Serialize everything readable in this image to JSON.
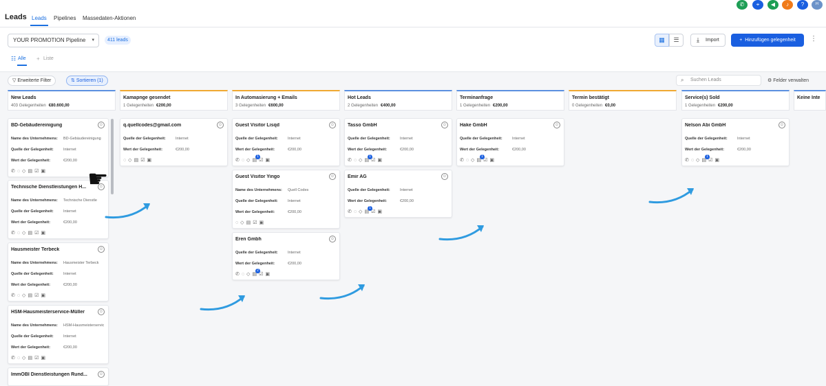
{
  "header": {
    "title": "Leads",
    "tabs": [
      "Leads",
      "Pipelines",
      "Massedaten-Aktionen"
    ],
    "active_tab": "Leads",
    "icons": [
      {
        "name": "phone-icon",
        "color": "#1e9e55",
        "glyph": "✆"
      },
      {
        "name": "dialer-icon",
        "color": "#1a5fe0",
        "glyph": "⌖"
      },
      {
        "name": "megaphone-icon",
        "color": "#1e9e55",
        "glyph": "◀"
      },
      {
        "name": "bell-icon",
        "color": "#f07b1a",
        "glyph": "♪"
      },
      {
        "name": "help-icon",
        "color": "#1a5fe0",
        "glyph": "?"
      },
      {
        "name": "user-avatar-icon",
        "color": "#6c93c9",
        "glyph": "ᴴ"
      }
    ]
  },
  "toolbar": {
    "pipeline": "YOUR PROMOTION Pipeline",
    "lead_count": "411 leads",
    "import_label": "Import",
    "add_label": "Hinzufügen gelegenheit",
    "view_tabs": [
      "Alle",
      "Liste"
    ]
  },
  "filters": {
    "extended": "Erweiterte Filter",
    "sort": "Sortieren (1)",
    "search_placeholder": "Suchen Leads",
    "manage_fields": "Felder verwalten"
  },
  "labels": {
    "company": "Name des Unternehmens:",
    "source": "Quelle der Gelegenheit:",
    "value": "Wert der Gelegenheit:"
  },
  "columns": [
    {
      "title": "New Leads",
      "count": "403 Gelegenheiten",
      "amount": "€80.600,00",
      "color": "#5a8fe0",
      "cards": [
        {
          "name": "BD-Gebäudereinigung",
          "company": "BD-Gebäudereinigung",
          "source": "Internet",
          "value": "€200,00"
        },
        {
          "name": "Technische Dienstleistungen H...",
          "company": "Technische Dienstle",
          "source": "Internet",
          "value": "€200,00"
        },
        {
          "name": "Hausmeister Terbeck",
          "company": "Hausmeister Terbeck",
          "source": "Internet",
          "value": "€200,00"
        },
        {
          "name": "HSM-Hausmeisterservice-Müller",
          "company": "HSM-Hausmeisterservic",
          "source": "Internet",
          "value": "€200,00"
        },
        {
          "name": "ImmOBI Dienstleistungen Rund...",
          "company": "",
          "source": "",
          "value": ""
        }
      ]
    },
    {
      "title": "Kamapnge gesendet",
      "count": "1 Gelegenheiten",
      "amount": "€200,00",
      "color": "#f0a830",
      "cards": [
        {
          "name": "q.quellcodes@gmail.com",
          "company": "",
          "source": "Internet",
          "value": "€200,00"
        }
      ]
    },
    {
      "title": "In Automasierung + Emails",
      "count": "3 Gelegenheiten",
      "amount": "€600,00",
      "color": "#f0a830",
      "cards": [
        {
          "name": "Guest Visitor Lisqd",
          "company": "",
          "source": "Internet",
          "value": "€200,00",
          "badge": "1"
        },
        {
          "name": "Guest Visitor Yingo",
          "company": "Quell Codes",
          "source": "Internet",
          "value": "€200,00"
        },
        {
          "name": "Eren Gmbh",
          "company": "",
          "source": "Internet",
          "value": "€200,00",
          "badge": "2"
        }
      ]
    },
    {
      "title": "Hot Leads",
      "count": "2 Gelegenheiten",
      "amount": "€400,00",
      "color": "#5a8fe0",
      "cards": [
        {
          "name": "Tasso GmbH",
          "company": "",
          "source": "Internet",
          "value": "€200,00",
          "badge": "1"
        },
        {
          "name": "Emir AG",
          "company": "",
          "source": "Internet",
          "value": "€200,00",
          "badge": "1"
        }
      ]
    },
    {
      "title": "Terminanfrage",
      "count": "1 Gelegenheiten",
      "amount": "€200,00",
      "color": "#5a8fe0",
      "cards": [
        {
          "name": "Hake GmbH",
          "company": "",
          "source": "Internet",
          "value": "€200,00",
          "badge": "1"
        }
      ]
    },
    {
      "title": "Termin bestätigt",
      "count": "0 Gelegenheiten",
      "amount": "€0,00",
      "color": "#f0a830",
      "cards": []
    },
    {
      "title": "Service(s) Sold",
      "count": "1 Gelegenheiten",
      "amount": "€200,00",
      "color": "#5a8fe0",
      "cards": [
        {
          "name": "Nelson Abi GmbH",
          "company": "",
          "source": "Internet",
          "value": "€200,00",
          "badge": "1"
        }
      ]
    },
    {
      "title": "Keine Inte",
      "count": "",
      "amount": "",
      "color": "#5a8fe0",
      "cards": []
    }
  ]
}
